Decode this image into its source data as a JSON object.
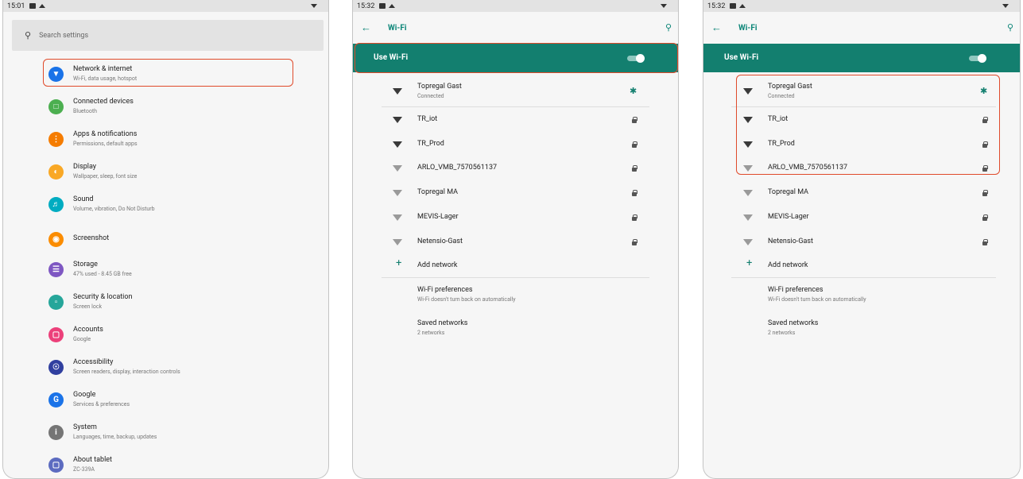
{
  "panel1": {
    "time": "15:01",
    "search_placeholder": "Search settings",
    "items": [
      {
        "title": "Network & internet",
        "sub": "Wi-Fi, data usage, hotspot",
        "color": "#1a73e8",
        "icon": "wifi-icon"
      },
      {
        "title": "Connected devices",
        "sub": "Bluetooth",
        "color": "#4caf50",
        "icon": "devices-icon"
      },
      {
        "title": "Apps & notifications",
        "sub": "Permissions, default apps",
        "color": "#f57c00",
        "icon": "apps-icon"
      },
      {
        "title": "Display",
        "sub": "Wallpaper, sleep, font size",
        "color": "#f9a825",
        "icon": "brightness-icon"
      },
      {
        "title": "Sound",
        "sub": "Volume, vibration, Do Not Disturb",
        "color": "#00acc1",
        "icon": "volume-icon"
      },
      {
        "title": "Screenshot",
        "sub": "",
        "color": "#fb8c00",
        "icon": "camera-icon"
      },
      {
        "title": "Storage",
        "sub": "47% used - 8.45 GB free",
        "color": "#7e57c2",
        "icon": "storage-icon"
      },
      {
        "title": "Security & location",
        "sub": "Screen lock",
        "color": "#26a69a",
        "icon": "lock-icon"
      },
      {
        "title": "Accounts",
        "sub": "Google",
        "color": "#ec407a",
        "icon": "account-icon"
      },
      {
        "title": "Accessibility",
        "sub": "Screen readers, display, interaction controls",
        "color": "#303f9f",
        "icon": "accessibility-icon"
      },
      {
        "title": "Google",
        "sub": "Services & preferences",
        "color": "#1a73e8",
        "icon": "google-icon"
      },
      {
        "title": "System",
        "sub": "Languages, time, backup, updates",
        "color": "#757575",
        "icon": "info-icon"
      },
      {
        "title": "About tablet",
        "sub": "ZC-339A",
        "color": "#5c6bc0",
        "icon": "tablet-icon"
      }
    ]
  },
  "panel2": {
    "time": "15:32",
    "title": "Wi-Fi",
    "use_wifi": "Use Wi-Fi",
    "toggle_on": true,
    "connected": {
      "name": "Topregal Gast",
      "sub": "Connected"
    },
    "networks": [
      {
        "name": "TR_iot",
        "strength": "strong"
      },
      {
        "name": "TR_Prod",
        "strength": "strong"
      },
      {
        "name": "ARLO_VMB_7570561137",
        "strength": "weak"
      },
      {
        "name": "Topregal MA",
        "strength": "weak"
      },
      {
        "name": "MEVIS-Lager",
        "strength": "weak"
      },
      {
        "name": "Netensio-Gast",
        "strength": "weak"
      }
    ],
    "add_network": "Add network",
    "prefs_title": "Wi-Fi preferences",
    "prefs_sub": "Wi-Fi doesn't turn back on automatically",
    "saved_title": "Saved networks",
    "saved_sub": "2 networks"
  },
  "panel3": {
    "time": "15:32",
    "title": "Wi-Fi",
    "use_wifi": "Use Wi-Fi",
    "toggle_on": true,
    "connected": {
      "name": "Topregal Gast",
      "sub": "Connected"
    },
    "networks": [
      {
        "name": "TR_iot",
        "strength": "strong"
      },
      {
        "name": "TR_Prod",
        "strength": "strong"
      },
      {
        "name": "ARLO_VMB_7570561137",
        "strength": "weak"
      },
      {
        "name": "Topregal MA",
        "strength": "weak"
      },
      {
        "name": "MEVIS-Lager",
        "strength": "weak"
      },
      {
        "name": "Netensio-Gast",
        "strength": "weak"
      }
    ],
    "add_network": "Add network",
    "prefs_title": "Wi-Fi preferences",
    "prefs_sub": "Wi-Fi doesn't turn back on automatically",
    "saved_title": "Saved networks",
    "saved_sub": "2 networks"
  },
  "colors": {
    "accent": "#137f6f",
    "highlight": "#e04a2a"
  }
}
